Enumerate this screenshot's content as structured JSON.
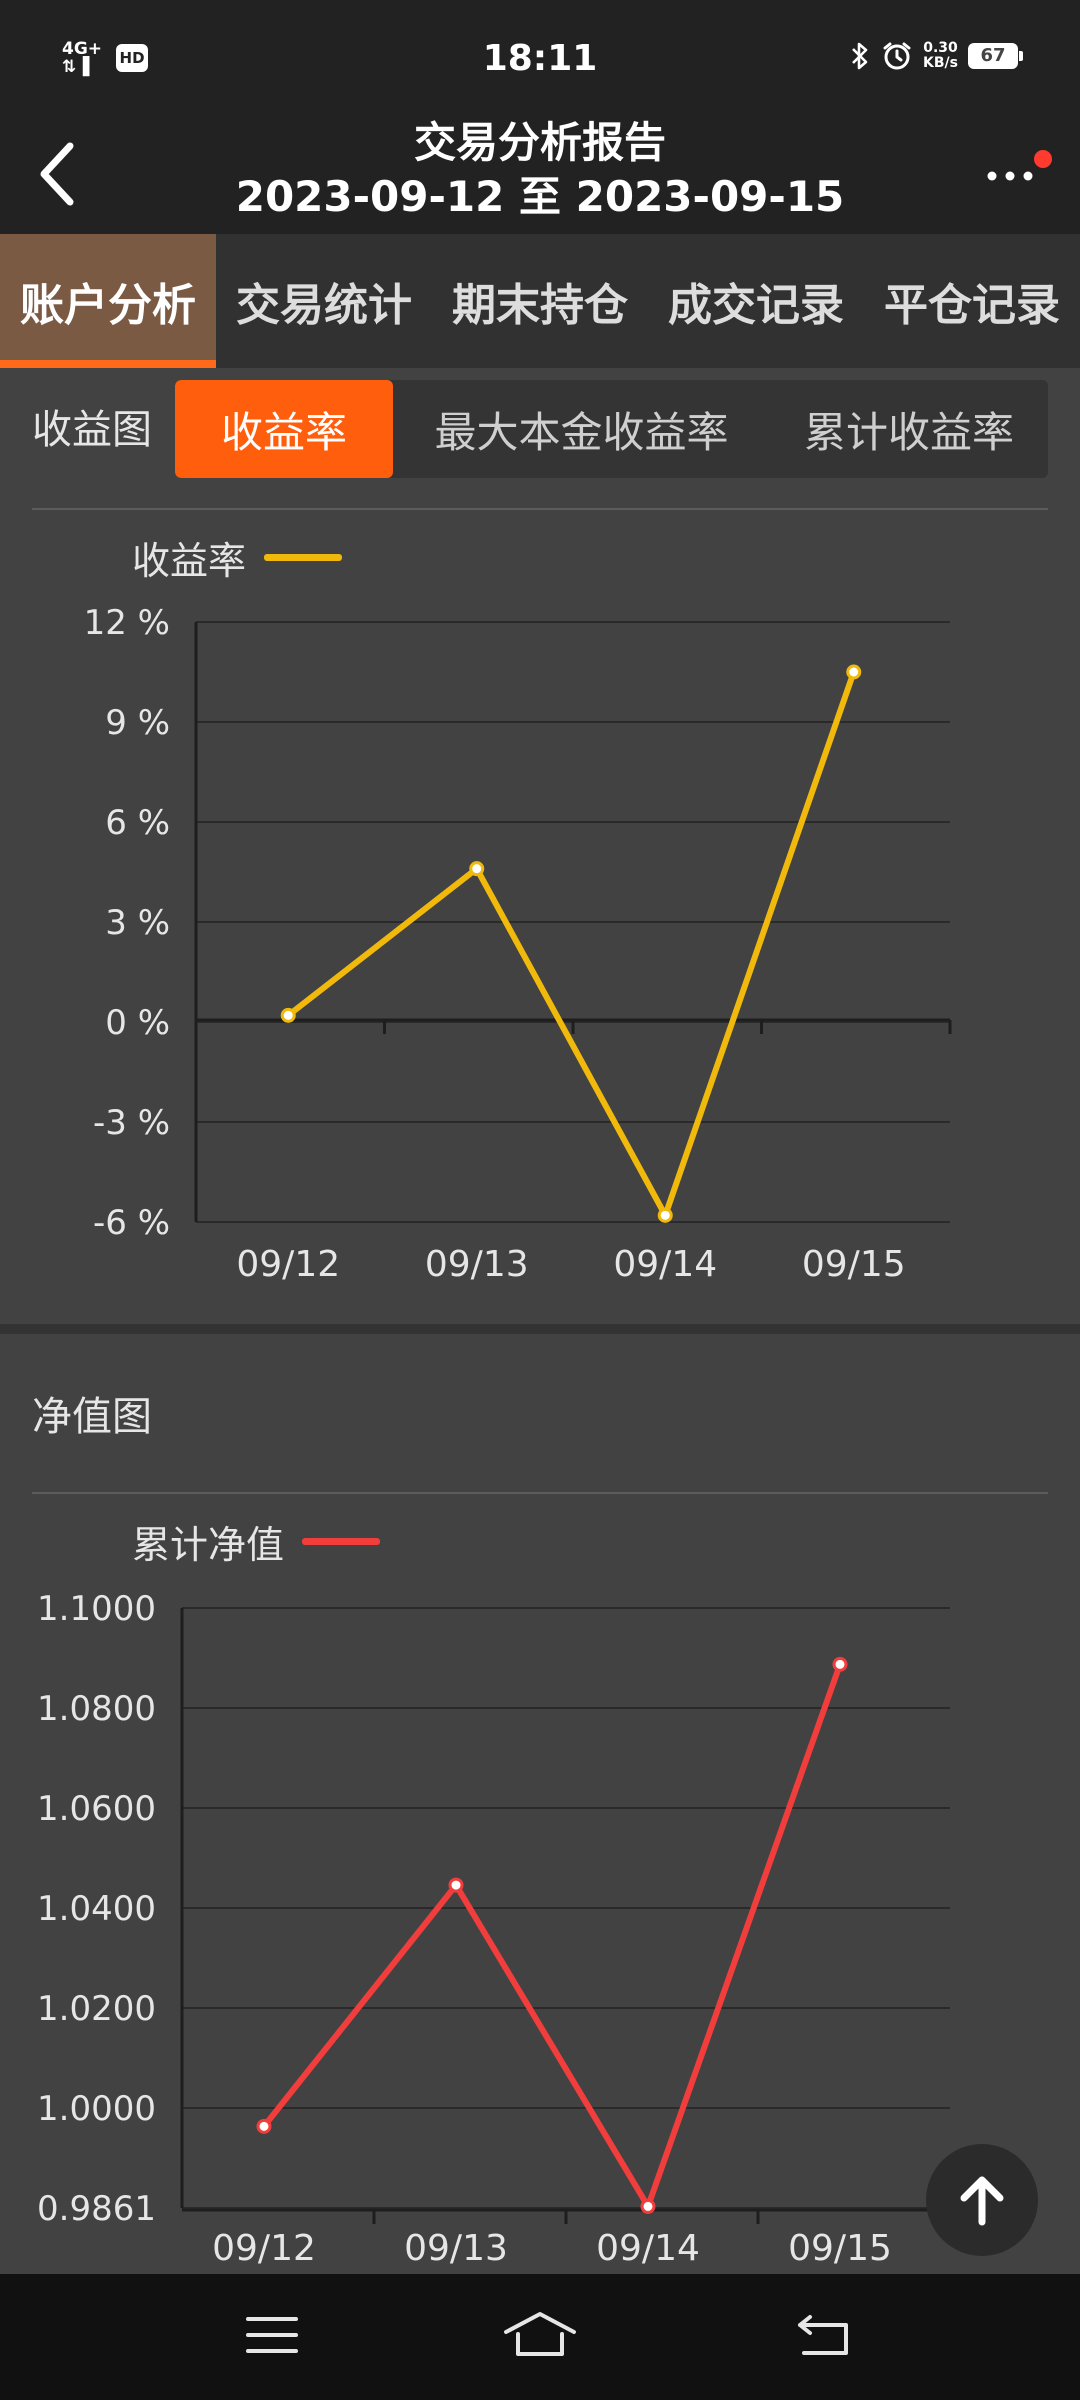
{
  "status_bar": {
    "network_top": "4G+",
    "network_bottom": "⇅▐",
    "hd": "HD",
    "time": "18:11",
    "speed_value": "0.30",
    "speed_unit": "KB/s",
    "battery": "67"
  },
  "header": {
    "title": "交易分析报告",
    "subtitle": "2023-09-12 至 2023-09-15"
  },
  "main_tabs": [
    {
      "label": "账户分析",
      "active": true
    },
    {
      "label": "交易统计",
      "active": false
    },
    {
      "label": "期末持仓",
      "active": false
    },
    {
      "label": "成交记录",
      "active": false
    },
    {
      "label": "平仓记录",
      "active": false
    }
  ],
  "chart_section": {
    "label": "收益图",
    "tabs": [
      {
        "label": "收益率",
        "active": true
      },
      {
        "label": "最大本金收益率",
        "active": false
      },
      {
        "label": "累计收益率",
        "active": false
      }
    ]
  },
  "nav_section": {
    "label": "净值图"
  },
  "chart_data": [
    {
      "type": "line",
      "categories": [
        "09/12",
        "09/13",
        "09/14",
        "09/15"
      ],
      "series": [
        {
          "name": "收益率",
          "values": [
            0.2,
            4.6,
            -5.8,
            10.5
          ],
          "color": "#f0b90b"
        }
      ],
      "yticks": [
        "12 %",
        "9 %",
        "6 %",
        "3 %",
        "0 %",
        "-3 %",
        "-6 %"
      ],
      "ylim": [
        -6,
        12
      ],
      "grid": true,
      "legend": "top-left"
    },
    {
      "type": "line",
      "categories": [
        "09/12",
        "09/13",
        "09/14",
        "09/15"
      ],
      "series": [
        {
          "name": "累计净值",
          "values": [
            1.0016,
            1.0474,
            0.9864,
            1.0893
          ],
          "color": "#f23d3d"
        }
      ],
      "yticks": [
        "1.1000",
        "1.0800",
        "1.0600",
        "1.0400",
        "1.0200",
        "1.0000",
        "0.9861"
      ],
      "ylim": [
        0.9861,
        1.1
      ],
      "grid": true,
      "legend": "top-left"
    }
  ],
  "icons": {
    "back": "chevron-left-icon",
    "more": "more-dots-icon",
    "top": "arrow-up-icon",
    "nav_menu": "menu-icon",
    "nav_home": "home-icon",
    "nav_back": "back-icon"
  }
}
